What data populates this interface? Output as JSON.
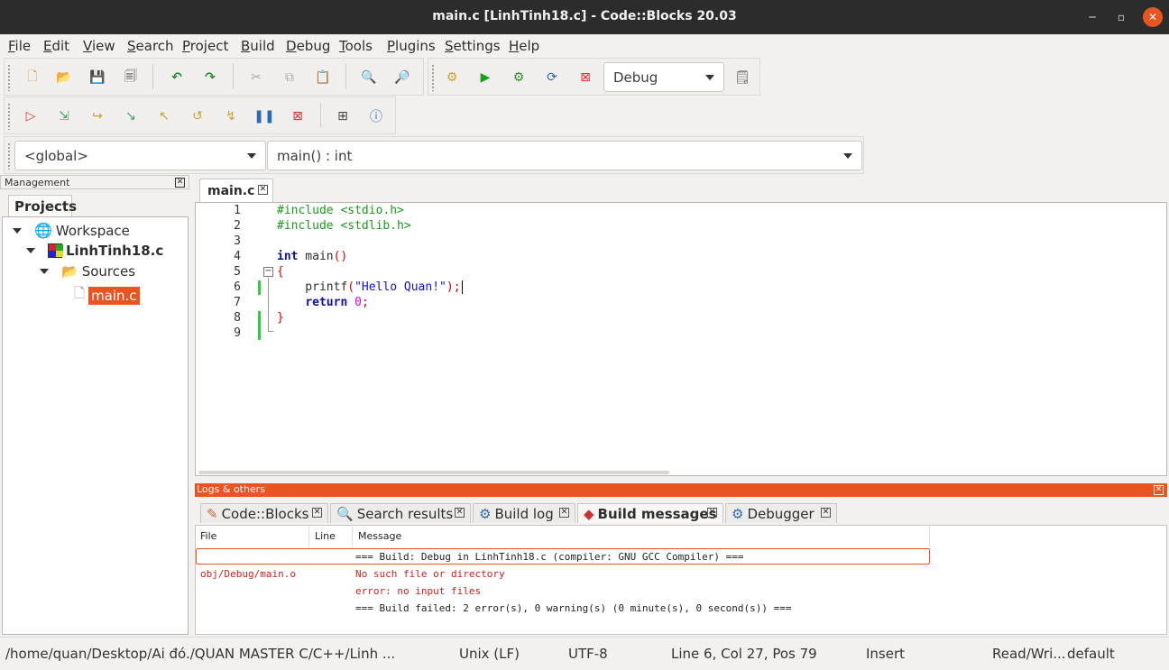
{
  "window": {
    "title": "main.c [LinhTinh18.c] - Code::Blocks 20.03"
  },
  "menu": [
    "File",
    "Edit",
    "View",
    "Search",
    "Project",
    "Build",
    "Debug",
    "Tools",
    "Plugins",
    "Settings",
    "Help"
  ],
  "toolbar": {
    "build_target": "Debug"
  },
  "code_completion": {
    "scope": "<global>",
    "function": "main() : int"
  },
  "management": {
    "title": "Management",
    "tab": "Projects",
    "tree": {
      "workspace": "Workspace",
      "project": "LinhTinh18.c",
      "folder": "Sources",
      "file": "main.c"
    }
  },
  "editor": {
    "tab": "main.c",
    "line_numbers": [
      "1",
      "2",
      "3",
      "4",
      "5",
      "6",
      "7",
      "8",
      "9"
    ],
    "lines": {
      "l1": "#include <stdio.h>",
      "l2": "#include <stdlib.h>",
      "l4_kw": "int",
      "l4_rest": " main",
      "l4_paren": "()",
      "l5": "{",
      "l6_a": "    printf",
      "l6_p1": "(",
      "l6_str": "\"Hello Quan!\"",
      "l6_p2": ")",
      "l6_semi": ";",
      "l7_kw": "return",
      "l7_num": "0",
      "l7_semi": ";",
      "l8": "}"
    }
  },
  "logs": {
    "title": "Logs & others",
    "tabs": [
      "Code::Blocks",
      "Search results",
      "Build log",
      "Build messages",
      "Debugger"
    ],
    "columns": {
      "file": "File",
      "line": "Line",
      "message": "Message"
    },
    "rows": [
      {
        "file": "",
        "line": "",
        "message": "=== Build: Debug in LinhTinh18.c (compiler: GNU GCC Compiler) ==="
      },
      {
        "file": "obj/Debug/main.o",
        "line": "",
        "message": "No such file or directory"
      },
      {
        "file": "",
        "line": "",
        "message": "error: no input files"
      },
      {
        "file": "",
        "line": "",
        "message": "=== Build failed: 2 error(s), 0 warning(s) (0 minute(s), 0 second(s)) ==="
      }
    ]
  },
  "status": {
    "path": "/home/quan/Desktop/Ai đó./QUAN MASTER C/C++/Linh ...",
    "line_endings": "Unix (LF)",
    "encoding": "UTF-8",
    "position": "Line 6, Col 27, Pos 79",
    "mode": "Insert",
    "access": "Read/Wri...",
    "lang": "default"
  },
  "colors": {
    "accent": "#e95420",
    "preprocessor": "#1b9a1b",
    "keyword": "#1010a0",
    "string": "#1010e0",
    "number": "#e000e0",
    "error": "#cc2222"
  }
}
